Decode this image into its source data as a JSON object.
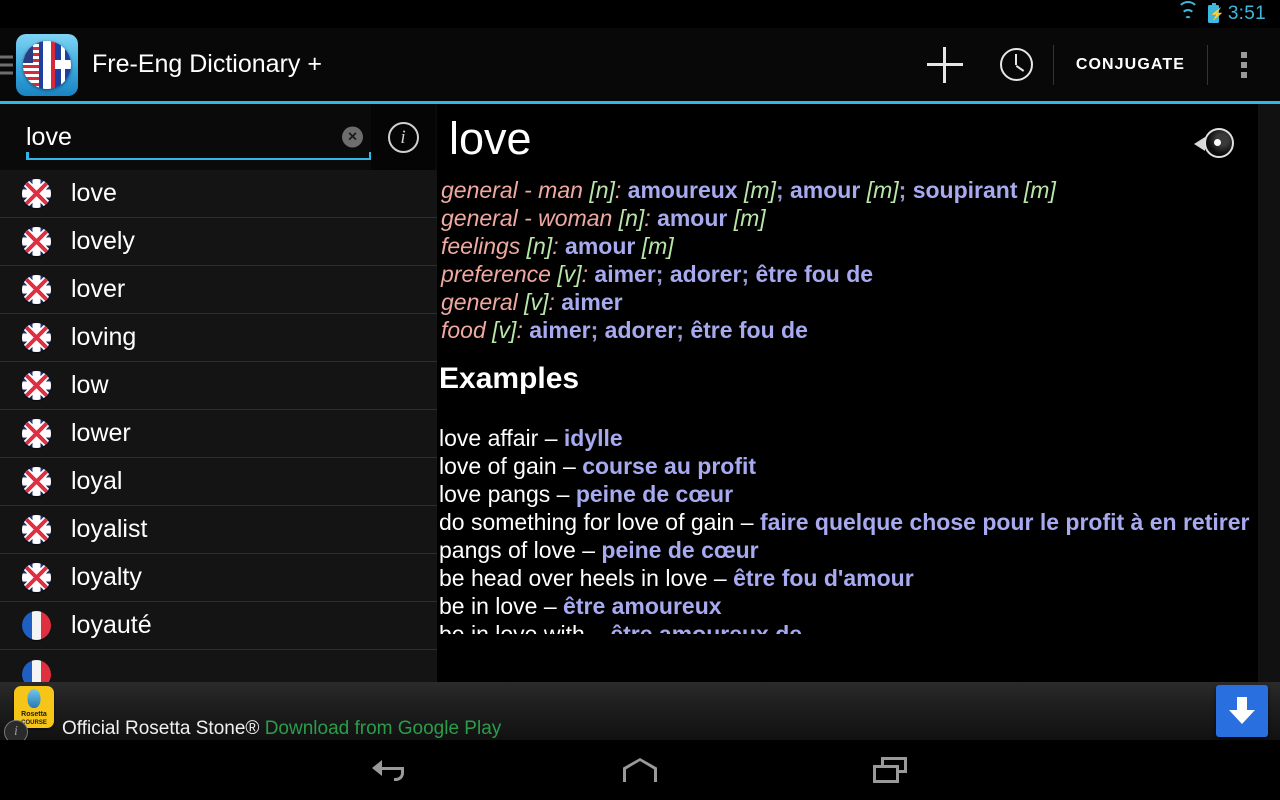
{
  "status_bar": {
    "time": "3:51",
    "wifi_icon": "wifi-icon",
    "battery_icon": "battery-charging-icon",
    "accent_color": "#3fb8e0"
  },
  "action_bar": {
    "title": "Fre-Eng Dictionary +",
    "app_icon": "app-flags-globe-icon",
    "add_label": "add-icon",
    "history_label": "history-clock-icon",
    "conjugate_label": "CONJUGATE",
    "overflow_label": "overflow-menu-icon",
    "accent_color": "#33b5e5"
  },
  "search": {
    "value": "love",
    "placeholder": "",
    "clear_label": "×",
    "info_label": "i"
  },
  "word_list": [
    {
      "word": "love",
      "flag": "uk"
    },
    {
      "word": "lovely",
      "flag": "uk"
    },
    {
      "word": "lover",
      "flag": "uk"
    },
    {
      "word": "loving",
      "flag": "uk"
    },
    {
      "word": "low",
      "flag": "uk"
    },
    {
      "word": "lower",
      "flag": "uk"
    },
    {
      "word": "loyal",
      "flag": "uk"
    },
    {
      "word": "loyalist",
      "flag": "uk"
    },
    {
      "word": "loyalty",
      "flag": "uk"
    },
    {
      "word": "loyauté",
      "flag": "fr"
    }
  ],
  "definition": {
    "headword": "love",
    "speaker_label": "speaker-icon",
    "senses": [
      {
        "context": "general - man",
        "pos": "[n]",
        "translations": [
          {
            "text": "amoureux",
            "gender": "[m]"
          },
          {
            "text": "amour",
            "gender": "[m]"
          },
          {
            "text": "soupirant",
            "gender": "[m]"
          }
        ]
      },
      {
        "context": "general - woman",
        "pos": "[n]",
        "translations": [
          {
            "text": "amour",
            "gender": "[m]"
          }
        ]
      },
      {
        "context": "feelings",
        "pos": "[n]",
        "translations": [
          {
            "text": "amour",
            "gender": "[m]"
          }
        ]
      },
      {
        "context": "preference",
        "pos": "[v]",
        "translations": [
          {
            "text": "aimer",
            "gender": ""
          },
          {
            "text": "adorer",
            "gender": ""
          },
          {
            "text": "être fou de",
            "gender": ""
          }
        ]
      },
      {
        "context": "general",
        "pos": "[v]",
        "translations": [
          {
            "text": "aimer",
            "gender": ""
          }
        ]
      },
      {
        "context": "food",
        "pos": "[v]",
        "translations": [
          {
            "text": "aimer",
            "gender": ""
          },
          {
            "text": "adorer",
            "gender": ""
          },
          {
            "text": "être fou de",
            "gender": ""
          }
        ]
      }
    ],
    "examples_title": "Examples",
    "examples": [
      {
        "source": "love affair",
        "target": "idylle"
      },
      {
        "source": "love of gain",
        "target": "course au profit"
      },
      {
        "source": "love pangs",
        "target": "peine de cœur"
      },
      {
        "source": "do something for love of gain",
        "target": "faire quelque chose pour le profit à en retirer"
      },
      {
        "source": "pangs of love",
        "target": "peine de cœur"
      },
      {
        "source": "be head over heels in love",
        "target": "être fou d'amour"
      },
      {
        "source": "be in love",
        "target": "être amoureux"
      },
      {
        "source": "be in love with",
        "target": "être amoureux de"
      }
    ],
    "separator": "–",
    "colors": {
      "context": "#f0a9a0",
      "tag": "#b8e6a8",
      "translation": "#a8aaf0",
      "source": "#ffffff"
    }
  },
  "ad": {
    "headline": "Official Rosetta Stone®",
    "cta": "Download from Google Play",
    "badge_name": "Rosetta",
    "badge_sub": "COURSE",
    "install_label": "install-download-icon",
    "info_label": "i",
    "accent_color": "#2a6fe0"
  },
  "nav_bar": {
    "back_label": "back-icon",
    "home_label": "home-icon",
    "recents_label": "recents-icon"
  }
}
